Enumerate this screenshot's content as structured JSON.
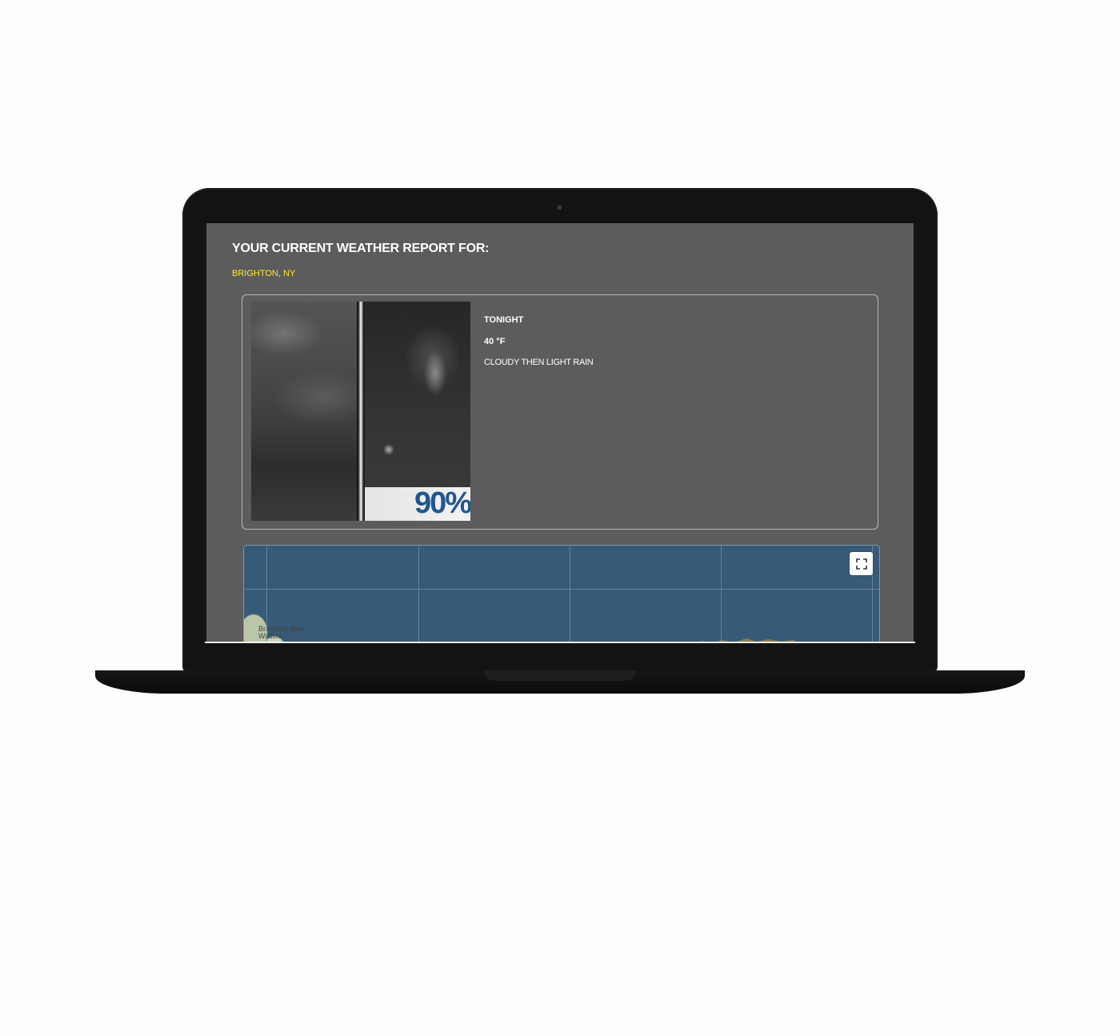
{
  "header": {
    "title": "YOUR CURRENT WEATHER REPORT FOR:",
    "location": "BRIGHTON, NY"
  },
  "forecast": {
    "period": "TONIGHT",
    "temperature": "40 °F",
    "description": "CLOUDY THEN LIGHT RAIN",
    "precipitation_chance": "90%",
    "icon": "cloudy-then-rain-icon"
  },
  "map": {
    "place_label": "Braddock Bay Wildlife",
    "fullscreen_icon": "fullscreen-icon"
  },
  "colors": {
    "page_background": "#5c5c5c",
    "location_text": "#ffea2a",
    "probability_text": "#21578e",
    "map_water": "#365a77"
  }
}
